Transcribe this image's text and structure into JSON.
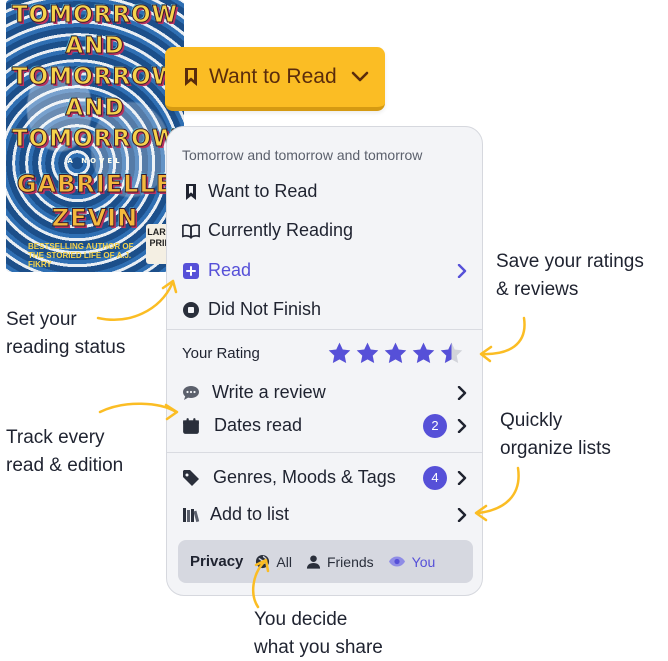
{
  "book": {
    "cover_lines": [
      "TOMORROW",
      "AND",
      "TOMORROW",
      "AND",
      "TOMORROW"
    ],
    "cover_tag": "A NOVEL",
    "author": [
      "GABRIELLE",
      "ZEVIN"
    ],
    "cover_blurb": "BESTSELLING AUTHOR OF THE STORIED LIFE OF A.J. FIKRY",
    "cover_badge": "LARGE PRINT"
  },
  "button": {
    "label": "Want to Read",
    "icon": "bookmark-icon"
  },
  "panel": {
    "title": "Tomorrow and tomorrow and tomorrow",
    "statuses": [
      {
        "label": "Want to Read",
        "icon": "bookmark-icon"
      },
      {
        "label": "Currently Reading",
        "icon": "open-book-icon"
      },
      {
        "label": "Read",
        "icon": "book-check-icon"
      },
      {
        "label": "Did Not Finish",
        "icon": "stop-circle-icon"
      }
    ],
    "rating": {
      "label": "Your Rating",
      "value": 4.5,
      "max": 5,
      "color": "#5650d8"
    },
    "review": {
      "label": "Write a review"
    },
    "dates": {
      "label": "Dates read",
      "count": "2"
    },
    "tags": {
      "label": "Genres, Moods & Tags",
      "count": "4"
    },
    "list": {
      "label": "Add to list"
    },
    "privacy": {
      "label": "Privacy",
      "options": [
        {
          "label": "All",
          "icon": "globe-icon"
        },
        {
          "label": "Friends",
          "icon": "person-icon"
        },
        {
          "label": "You",
          "icon": "eye-icon"
        }
      ],
      "selected": "You"
    }
  },
  "annotations": {
    "status": [
      "Set your",
      "reading status"
    ],
    "ratings": [
      "Save your ratings",
      "& reviews"
    ],
    "track": [
      "Track every",
      "read & edition"
    ],
    "lists": [
      "Quickly",
      "organize lists"
    ],
    "share": [
      "You decide",
      "what you share"
    ]
  },
  "colors": {
    "accent": "#5650d8",
    "button": "#fbbd24",
    "arrow": "#fbbd24"
  }
}
